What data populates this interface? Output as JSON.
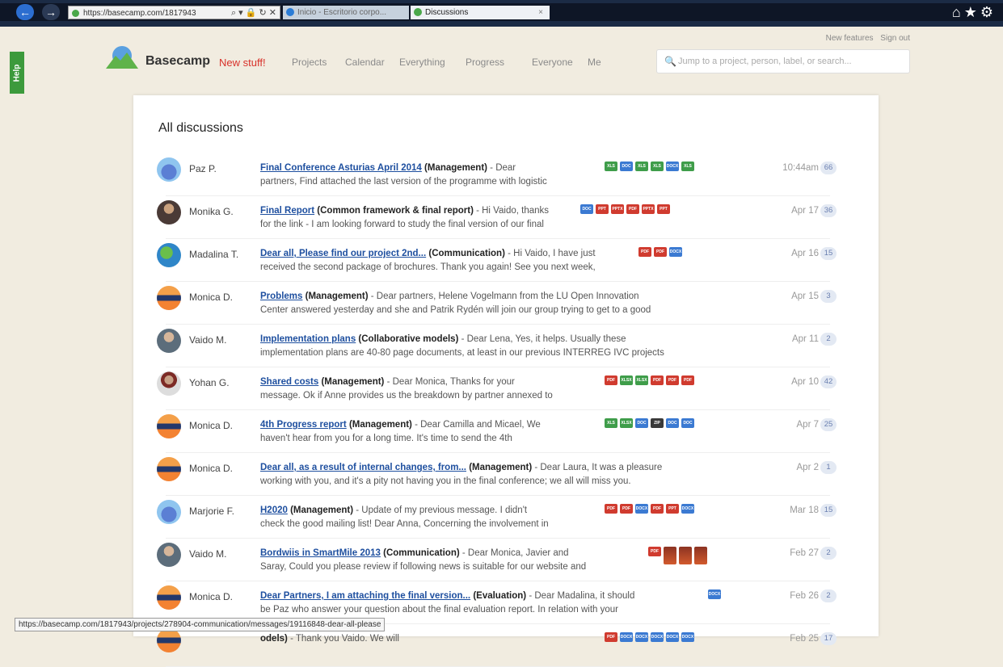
{
  "browser": {
    "url": "https://basecamp.com/1817943",
    "tabs": [
      {
        "label": "Inicio - Escritorio corpo..."
      },
      {
        "label": "Discussions"
      }
    ]
  },
  "help_label": "Help",
  "toplinks": {
    "new_features": "New features",
    "sign_out": "Sign out"
  },
  "header": {
    "brand": "Basecamp",
    "new_stuff": "New stuff!",
    "nav": [
      "Projects",
      "Calendar",
      "Everything",
      "Progress",
      "Everyone",
      "Me"
    ],
    "search_placeholder": "Jump to a project, person, label, or search..."
  },
  "main": {
    "title": "All discussions",
    "discussions": [
      {
        "author": "Paz P.",
        "title": "Final Conference Asturias April 2014",
        "project": "(Management)",
        "excerpt_1": " - Dear",
        "excerpt_2": "partners, Find attached the last version of the programme with logistic",
        "date": "10:44am",
        "count": "66",
        "files": [
          "XLS",
          "DOC",
          "XLS",
          "XLS",
          "DOCX",
          "XLS"
        ]
      },
      {
        "author": "Monika G.",
        "title": "Final Report",
        "project": "(Common framework & final report)",
        "excerpt_1": " - Hi Vaido, thanks",
        "excerpt_2": "for the link - I am looking forward to study the final version of our final",
        "date": "Apr 17",
        "count": "36",
        "files": [
          "DOC",
          "PPT",
          "PPTX",
          "PDF",
          "PPTX",
          "PPT"
        ]
      },
      {
        "author": "Madalina T.",
        "title": "Dear all, Please find our project 2nd...",
        "project": "(Communication)",
        "excerpt_1": " - Hi Vaido, I have just",
        "excerpt_2": "received the second package of brochures. Thank you again! See you next week,",
        "date": "Apr 16",
        "count": "15",
        "files": [
          "PDF",
          "PDF",
          "DOCX"
        ]
      },
      {
        "author": "Monica D.",
        "title": "Problems",
        "project": "(Management)",
        "excerpt_1": " - Dear partners, Helene Vogelmann from the LU Open Innovation",
        "excerpt_2": "Center answered yesterday and she and Patrik Rydén will join our group trying to get to a good",
        "date": "Apr 15",
        "count": "3",
        "files": []
      },
      {
        "author": "Vaido M.",
        "title": "Implementation plans",
        "project": "(Collaborative models)",
        "excerpt_1": " - Dear Lena, Yes, it helps. Usually these",
        "excerpt_2": "implementation plans are 40-80 page documents, at least in our previous INTERREG IVC projects",
        "date": "Apr 11",
        "count": "2",
        "files": []
      },
      {
        "author": "Yohan G.",
        "title": "Shared costs",
        "project": "(Management)",
        "excerpt_1": " - Dear Monica, Thanks for your",
        "excerpt_2": "message. Ok if Anne provides us the breakdown by partner annexed to",
        "date": "Apr 10",
        "count": "42",
        "files": [
          "PDF",
          "XLSX",
          "XLSX",
          "PDF",
          "PDF",
          "PDF"
        ]
      },
      {
        "author": "Monica D.",
        "title": "4th Progress report",
        "project": "(Management)",
        "excerpt_1": " - Dear Camilla and Micael, We",
        "excerpt_2": "haven't hear from you for a long time. It's time to send the 4th",
        "date": "Apr 7",
        "count": "25",
        "files": [
          "XLS",
          "XLSX",
          "DOC",
          "ZIP",
          "DOC",
          "DOC"
        ]
      },
      {
        "author": "Monica D.",
        "title": "Dear all, as a result of internal changes, from...",
        "project": "(Management)",
        "excerpt_1": " - Dear Laura, It was a pleasure",
        "excerpt_2": "working with you, and it's a pity not having you in the final conference; we all will miss you.",
        "date": "Apr 2",
        "count": "1",
        "files": []
      },
      {
        "author": "Marjorie F.",
        "title": "H2020",
        "project": "(Management)",
        "excerpt_1": " - Update of my previous message. I didn't",
        "excerpt_2": "check the good mailing list! Dear Anna, Concerning the involvement in",
        "date": "Mar 18",
        "count": "15",
        "files": [
          "PDF",
          "PDF",
          "DOCX",
          "PDF",
          "PPT",
          "DOCX"
        ]
      },
      {
        "author": "Vaido M.",
        "title": "Bordwiis in SmartMile 2013",
        "project": "(Communication)",
        "excerpt_1": " - Dear Monica, Javier and",
        "excerpt_2": "Saray, Could you please review if following news is suitable for our website and",
        "date": "Feb 27",
        "count": "2",
        "files": [
          "PDF",
          "IMG",
          "IMG",
          "IMG"
        ]
      },
      {
        "author": "Monica D.",
        "title": "Dear Partners, I am attaching the final version...",
        "project": "(Evaluation)",
        "excerpt_1": " - Dear Madalina, it should",
        "excerpt_2": "be Paz who answer your question about the final evaluation report. In relation with your",
        "date": "Feb 26",
        "count": "2",
        "files": [
          "DOCX"
        ]
      },
      {
        "author": "",
        "title": "",
        "project": "odels)",
        "excerpt_1": " - Thank you Vaido. We will",
        "excerpt_2": "",
        "date": "Feb 25",
        "count": "17",
        "files": [
          "PDF",
          "DOCX",
          "DOCX",
          "DOCX",
          "DOCX",
          "DOCX"
        ]
      }
    ]
  },
  "status_url": "https://basecamp.com/1817943/projects/278904-communication/messages/19116848-dear-all-please"
}
